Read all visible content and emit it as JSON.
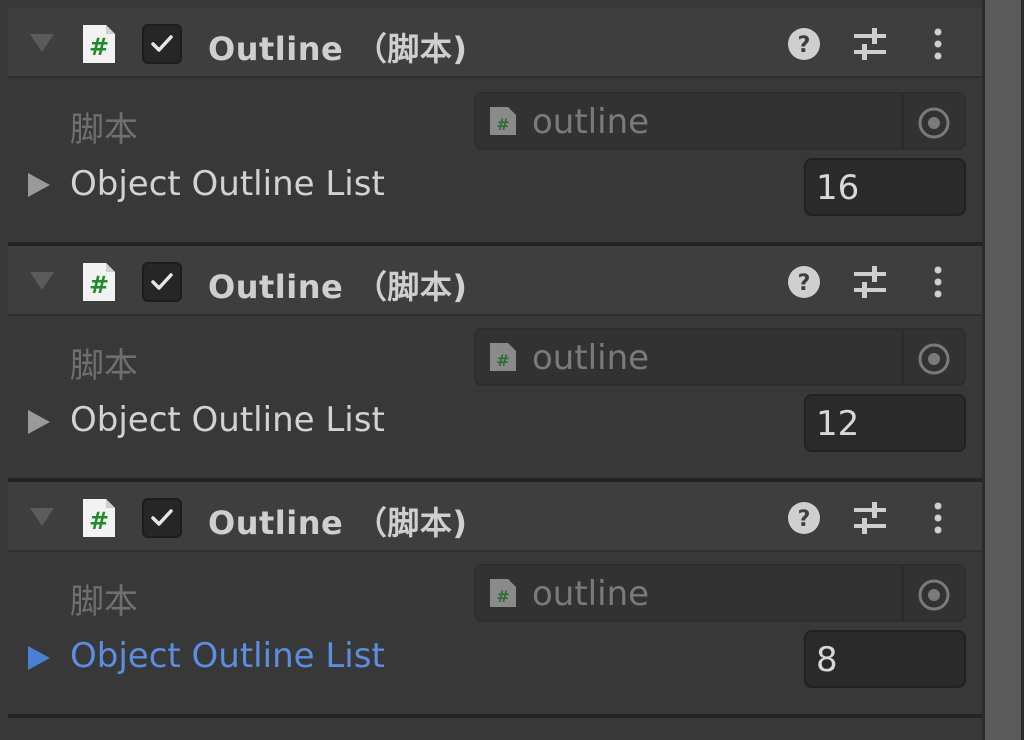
{
  "components": [
    {
      "title": "Outline （脚本)",
      "enabled": true,
      "script_label": "脚本",
      "script_value": "outline",
      "list_label": "Object Outline List",
      "list_count": "16",
      "list_selected": false
    },
    {
      "title": "Outline （脚本)",
      "enabled": true,
      "script_label": "脚本",
      "script_value": "outline",
      "list_label": "Object Outline List",
      "list_count": "12",
      "list_selected": false
    },
    {
      "title": "Outline （脚本)",
      "enabled": true,
      "script_label": "脚本",
      "script_value": "outline",
      "list_label": "Object Outline List",
      "list_count": "8",
      "list_selected": true
    }
  ],
  "icons": {
    "script": "csharp-script-icon",
    "help": "help-icon",
    "presets": "presets-icon",
    "menu": "more-vertical-icon",
    "picker": "object-picker-icon"
  },
  "colors": {
    "accent": "#5b8ee0",
    "script_hash": "#1f8b2a"
  }
}
